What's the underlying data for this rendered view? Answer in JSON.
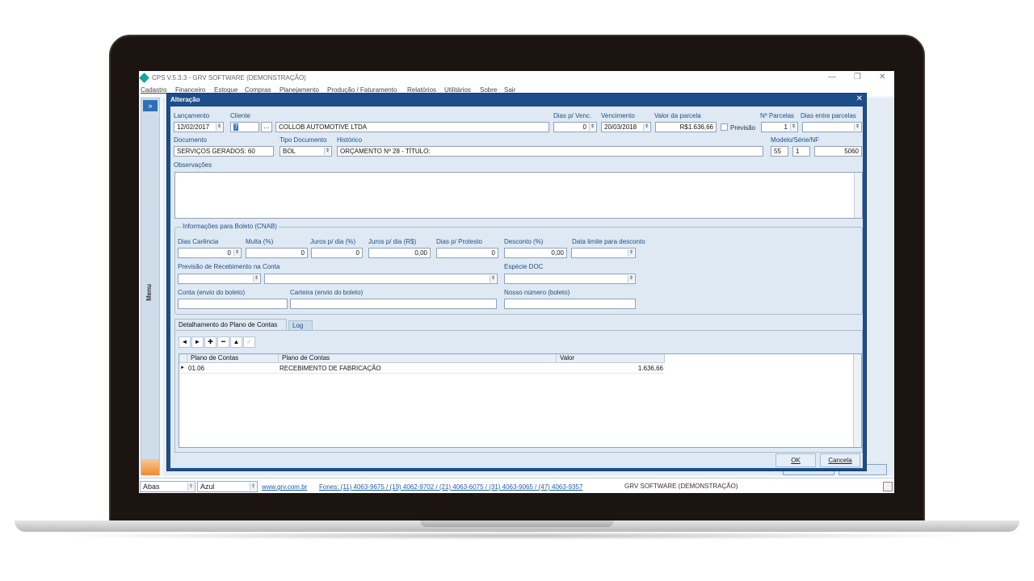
{
  "app": {
    "title": "CPS V.5.3.3 - GRV SOFTWARE (DEMONSTRAÇÃO)",
    "window_controls": {
      "minimize": "—",
      "restore": "❐",
      "close": "✕"
    }
  },
  "menu": [
    "Cadastro",
    "Financeiro",
    "Estoque",
    "Compras",
    "Planejamento",
    "Produção / Faturamento",
    "Relatórios",
    "Utilitários",
    "Sobre",
    "Sair"
  ],
  "side_menu": {
    "expand": "»",
    "label": "Menu"
  },
  "dialog": {
    "title": "Alteração",
    "close": "✕",
    "labels": {
      "lancamento": "Lançamento",
      "cliente": "Cliente",
      "dias_venc": "Dias p/ Venc.",
      "vencimento": "Vencimento",
      "valor_parcela": "Valor da parcela",
      "n_parcelas": "Nº Parcelas",
      "dias_entre": "Dias entre parcelas",
      "documento": "Documento",
      "tipo_documento": "Tipo Documento",
      "historico": "Histórico",
      "modelo_serie_nf": "Modelo/Série/NF",
      "observacoes": "Observações",
      "previsao": "Previsão"
    },
    "values": {
      "lancamento": "12/02/2017",
      "cliente_code": "7",
      "cliente_name": "COLLOB AUTOMOTIVE LTDA",
      "dias_venc": "0",
      "vencimento": "20/03/2018",
      "valor_parcela": "R$1.636,66",
      "n_parcelas": "1",
      "dias_entre": "",
      "documento": "SERVIÇOS GERADOS: 60",
      "tipo_documento": "BOL",
      "historico": "ORÇAMENTO Nº 28 - TÍTULO:",
      "modelo": "55",
      "serie": "1",
      "nf": "5060",
      "observacoes": ""
    },
    "boleto": {
      "group_title": "Informações para Boleto (CNAB)",
      "labels": {
        "dias_carencia": "Dias Carência",
        "multa": "Multa (%)",
        "juros_pct": "Juros p/ dia (%)",
        "juros_rs": "Juros p/ dia (R$)",
        "dias_protesto": "Dias p/ Protesto",
        "desconto": "Desconto (%)",
        "data_limite": "Data limite para desconto",
        "previsao_recebimento": "Previsão de Recebimento na Conta",
        "especie_doc": "Espécie DOC",
        "conta": "Conta (envio do boleto)",
        "carteira": "Carteira (envio do boleto)",
        "nosso_numero": "Nosso número (boleto)"
      },
      "values": {
        "dias_carencia": "0",
        "multa": "0",
        "juros_pct": "0",
        "juros_rs": "0,00",
        "dias_protesto": "0",
        "desconto": "0,00",
        "data_limite": "",
        "previsao_recebimento_1": "",
        "previsao_recebimento_2": "",
        "especie_doc": "",
        "conta": "",
        "carteira": "",
        "nosso_numero": ""
      }
    },
    "tabs": [
      "Detalhamento do Plano de Contas",
      "Log"
    ],
    "nav_buttons": [
      "◄",
      "►",
      "✚",
      "━",
      "▲",
      "✓"
    ],
    "grid": {
      "columns": [
        "Plano de Contas",
        "Plano de Contas",
        "Valor"
      ],
      "rows": [
        {
          "indicator": "►",
          "codigo": "01.06",
          "descricao": "RECEBIMENTO DE FABRICAÇÃO",
          "valor": "1.636,66"
        }
      ]
    },
    "buttons": {
      "ok": "OK",
      "cancelar": "Cancela"
    }
  },
  "statusbar": {
    "abas": "Abas",
    "tema": "Azul",
    "site": "www.grv.com.br",
    "fones": "Fones: (11) 4063-9675 / (19) 4062-9702 / (21) 4063-6075 / (31) 4063-9065 / (47) 4063-9357",
    "company": "GRV SOFTWARE (DEMONSTRAÇÃO)"
  }
}
